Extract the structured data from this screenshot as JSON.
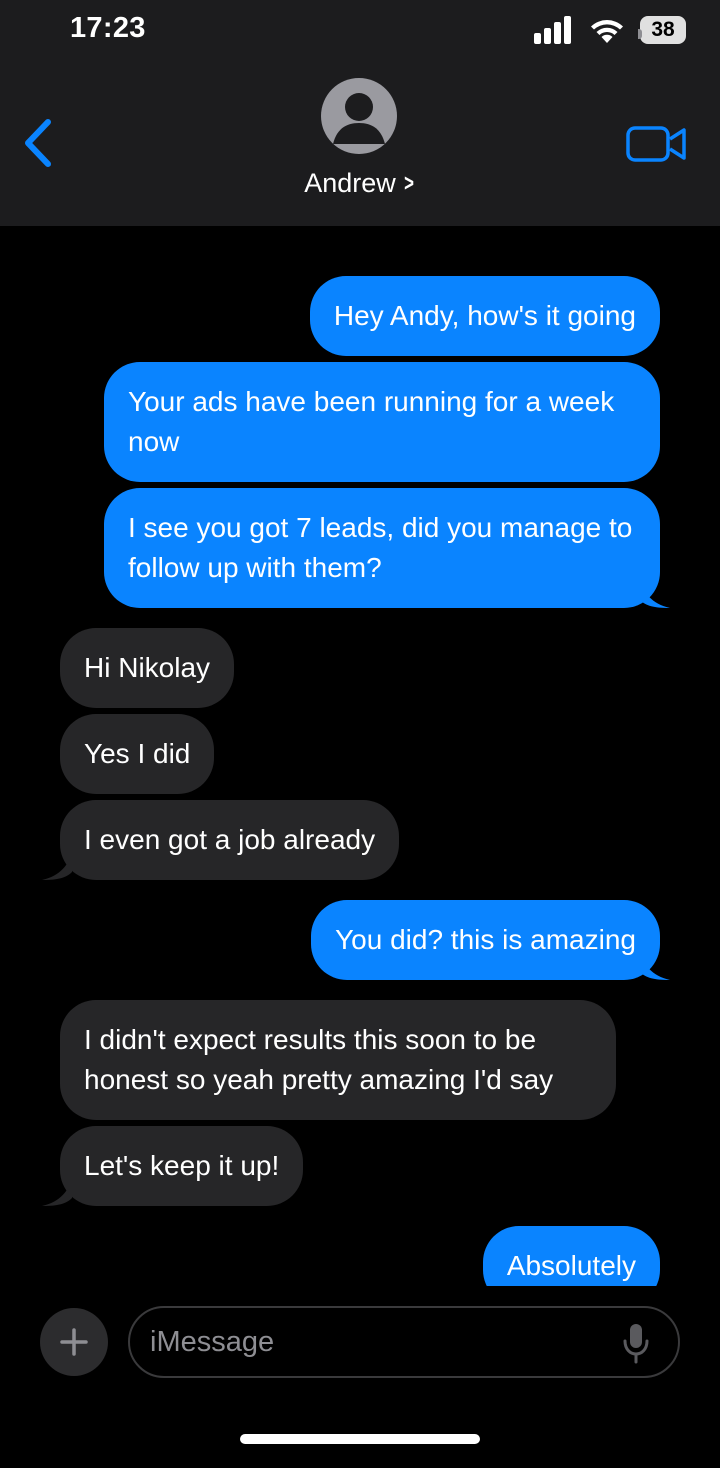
{
  "status_bar": {
    "time": "17:23",
    "battery": "38"
  },
  "header": {
    "contact_name": "Andrew",
    "chevron": ">"
  },
  "messages": [
    {
      "from": "me",
      "text": "Hey Andy, how's it going"
    },
    {
      "from": "me",
      "text": "Your ads have been running for a week now"
    },
    {
      "from": "me",
      "text": "I see you got 7 leads, did you manage to follow up with them?"
    },
    {
      "from": "them",
      "text": "Hi Nikolay"
    },
    {
      "from": "them",
      "text": "Yes I did"
    },
    {
      "from": "them",
      "text": "I even got a job already"
    },
    {
      "from": "me",
      "text": "You did? this is amazing"
    },
    {
      "from": "them",
      "text": "I didn't expect results this soon to be honest so yeah pretty amazing I'd say"
    },
    {
      "from": "them",
      "text": "Let's keep it up!"
    },
    {
      "from": "me",
      "text": "Absolutely"
    }
  ],
  "composer": {
    "placeholder": "iMessage"
  },
  "colors": {
    "sent_bubble": "#0a84ff",
    "received_bubble": "#262628",
    "header_bg": "#1c1c1e",
    "accent": "#0a84ff"
  },
  "icons": {
    "back": "chevron-left-icon",
    "video": "video-camera-icon",
    "avatar": "person-icon",
    "plus": "plus-icon",
    "mic": "microphone-icon"
  }
}
